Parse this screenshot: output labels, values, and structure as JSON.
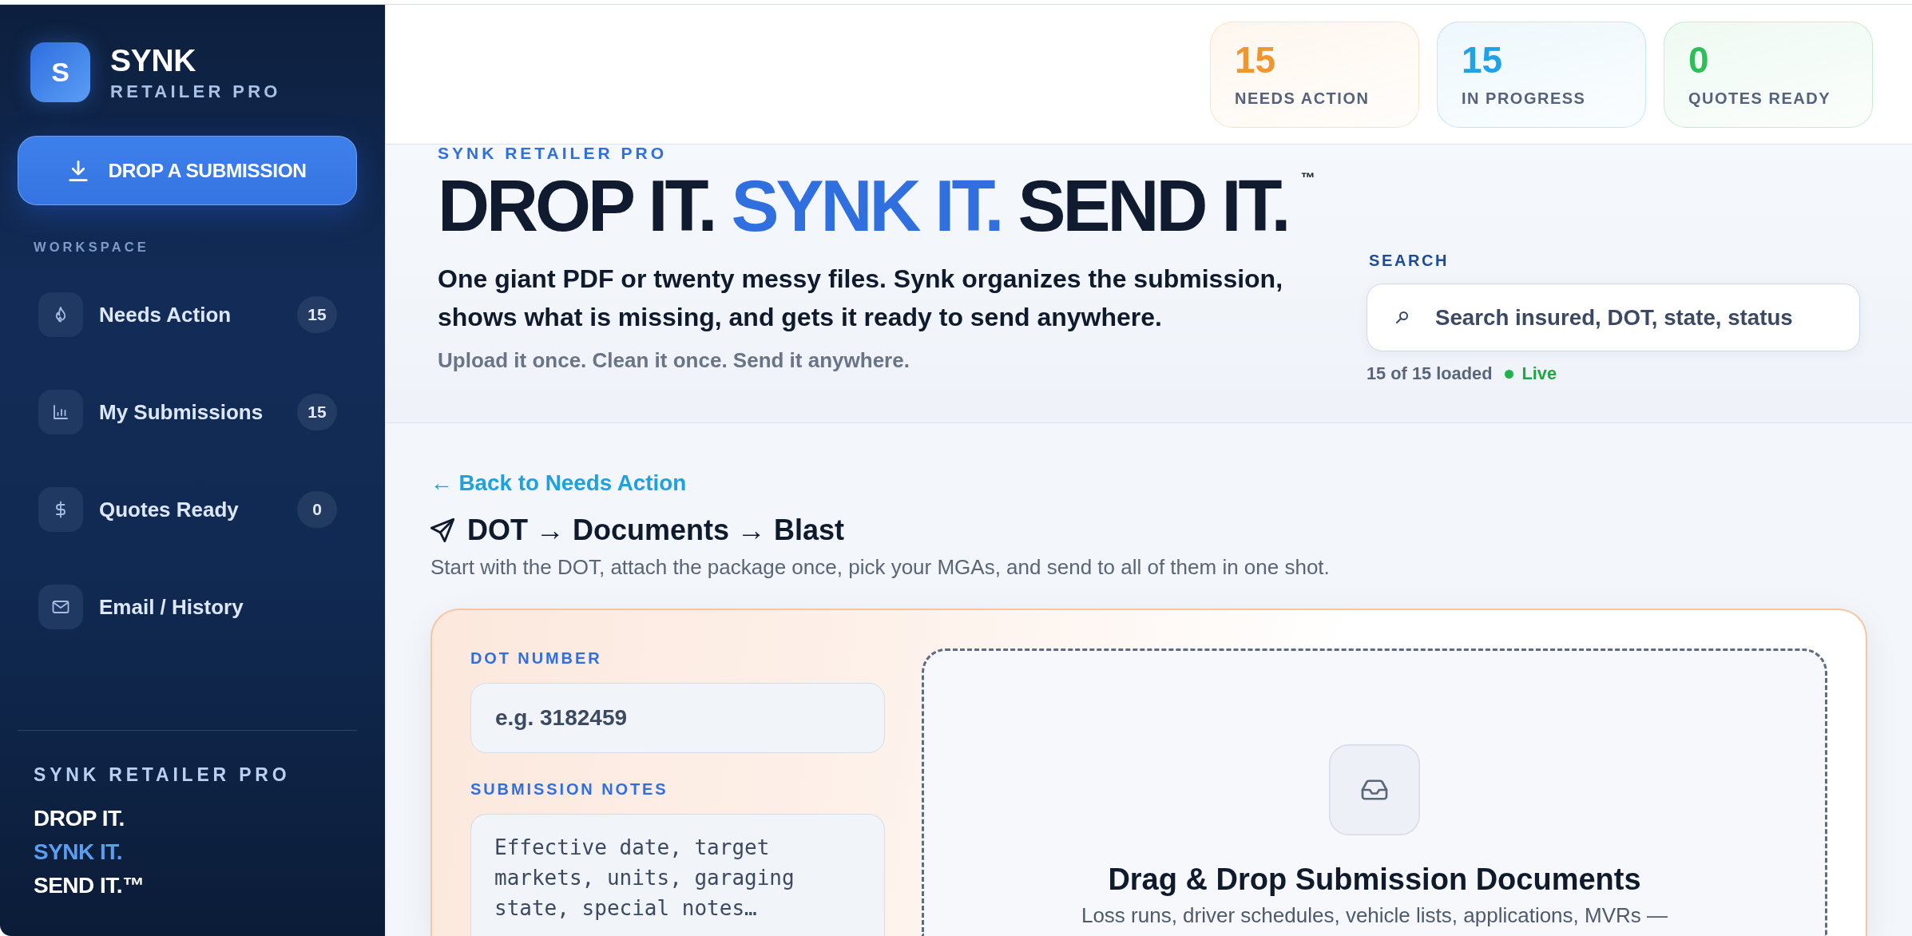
{
  "sidebar": {
    "logo": {
      "letter": "S"
    },
    "brand_name": "SYNK",
    "brand_subtitle": "RETAILER PRO",
    "drop_button": {
      "label": "DROP A SUBMISSION"
    },
    "section_label": "WORKSPACE",
    "items": [
      {
        "label": "Needs Action",
        "count": "15",
        "selected": false
      },
      {
        "label": "My Submissions",
        "count": "15",
        "selected": false
      },
      {
        "label": "Quotes Ready",
        "count": "0",
        "selected": false
      },
      {
        "label": "Email / History",
        "selected": false
      }
    ],
    "footer": {
      "title": "SYNK RETAILER PRO",
      "taglines": [
        {
          "text": "DROP IT.",
          "highlight": false
        },
        {
          "text": "SYNK IT.",
          "highlight": true
        },
        {
          "text": "SEND IT.™",
          "highlight": false
        }
      ]
    }
  },
  "header": {
    "stats": [
      {
        "value": "15",
        "label": "NEEDS ACTION",
        "color": "#f0962c"
      },
      {
        "value": "15",
        "label": "IN PROGRESS",
        "color": "#1fa2e6"
      },
      {
        "value": "0",
        "label": "QUOTES READY",
        "color": "#2ebf5a"
      }
    ]
  },
  "hero": {
    "eyebrow": "SYNK RETAILER PRO",
    "headline": [
      {
        "text": "DROP IT.",
        "highlight": false
      },
      {
        "text": "SYNK IT.",
        "highlight": true
      },
      {
        "text": "SEND IT.",
        "highlight": false
      }
    ],
    "trademark": "™",
    "description": "One giant PDF or twenty messy files. Synk organizes the submission, shows what is missing, and gets it ready to send anywhere.",
    "tagline": "Upload it once. Clean it once. Send it anywhere.",
    "search": {
      "label": "SEARCH",
      "placeholder": "Search insured, DOT, state, status",
      "status": "15 of 15 loaded",
      "live": {
        "label": "Live",
        "on": true
      }
    }
  },
  "workflow": {
    "back_link": "← Back to Needs Action",
    "title": "DOT → Documents → Blast",
    "description": "Start with the DOT, attach the package once, pick your MGAs, and send to all of them in one shot.",
    "form": {
      "fields": [
        {
          "kind": "input",
          "label": "DOT NUMBER",
          "placeholder": "e.g. 3182459"
        },
        {
          "kind": "textarea",
          "label": "SUBMISSION NOTES",
          "placeholder": "Effective date, target markets, units, garaging state, special notes…"
        }
      ]
    },
    "dropzone": {
      "title": "Drag & Drop Submission Documents",
      "hint": "Loss runs, driver schedules, vehicle lists, applications, MVRs —"
    }
  }
}
